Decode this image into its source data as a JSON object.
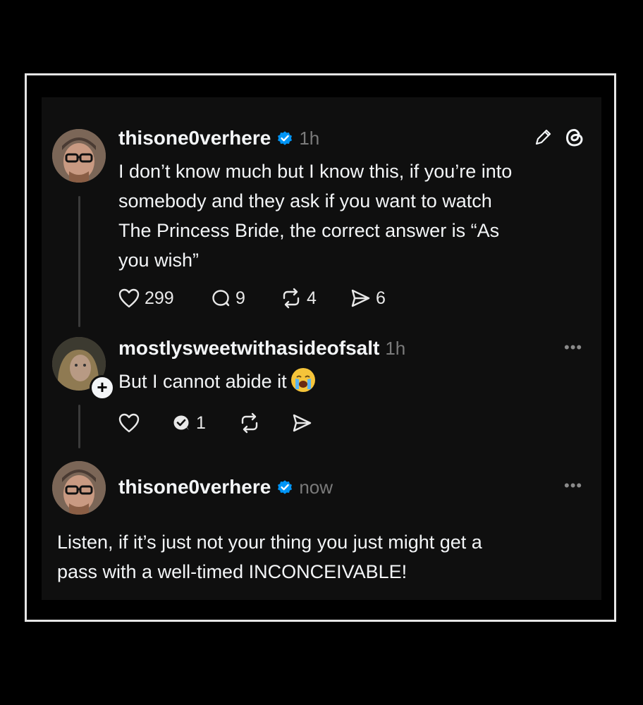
{
  "posts": [
    {
      "username": "thisone0verhere",
      "verified": true,
      "time": "1h",
      "text_lines": [
        "I don’t know much but I know this, if you’re into",
        "somebody and they ask if you want to watch",
        "The Princess Bride, the correct answer is “As",
        "you wish”"
      ],
      "likes": "299",
      "replies": "9",
      "reposts": "4",
      "shares": "6",
      "header_icons": [
        "edit-icon",
        "threads-logo-icon"
      ]
    },
    {
      "username": "mostlysweetwithasideofsalt",
      "verified": false,
      "time": "1h",
      "text": "But I cannot abide it",
      "emoji": "loudly-crying-face",
      "replies": "1",
      "follow_badge": "+"
    },
    {
      "username": "thisone0verhere",
      "verified": true,
      "time": "now",
      "text_lines": [
        "Listen, if it’s just not your thing you just might get a",
        "pass with a well-timed INCONCEIVABLE!"
      ]
    }
  ],
  "colors": {
    "background": "#0f0f0f",
    "verified_blue": "#0095f6",
    "text": "#f3f5f7",
    "muted": "#7a7a7a"
  },
  "more_label": "•••"
}
